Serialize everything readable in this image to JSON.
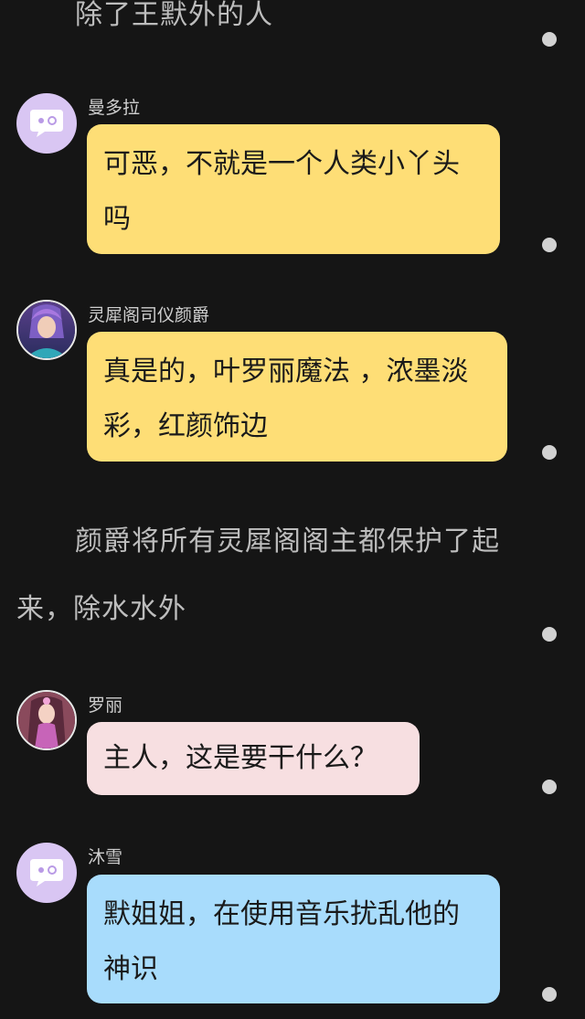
{
  "narration": {
    "top_line": "除了王默外的人",
    "middle_line1": "颜爵将所有灵犀阁阁主都保护了起",
    "middle_line2": "来，除水水外"
  },
  "messages": [
    {
      "name": "曼多拉",
      "line1": "可恶，不就是一个人类小丫头",
      "line2": "吗",
      "avatar": "chat-bubble-icon"
    },
    {
      "name": "灵犀阁司仪颜爵",
      "line1": "真是的，叶罗丽魔法 ，浓墨淡",
      "line2": "彩，红颜饰边",
      "avatar": "character-portrait"
    },
    {
      "name": "罗丽",
      "line1": "主人，这是要干什么？",
      "avatar": "character-portrait"
    },
    {
      "name": "沐雪",
      "line1": "默姐姐，在使用音乐扰乱他的",
      "line2": "神识",
      "avatar": "chat-bubble-icon"
    }
  ],
  "colors": {
    "background": "#151515",
    "bubble_yellow": "#fede76",
    "bubble_pink": "#f7dfe1",
    "bubble_blue": "#a8dcfc",
    "default_avatar": "#d9c6f3"
  }
}
